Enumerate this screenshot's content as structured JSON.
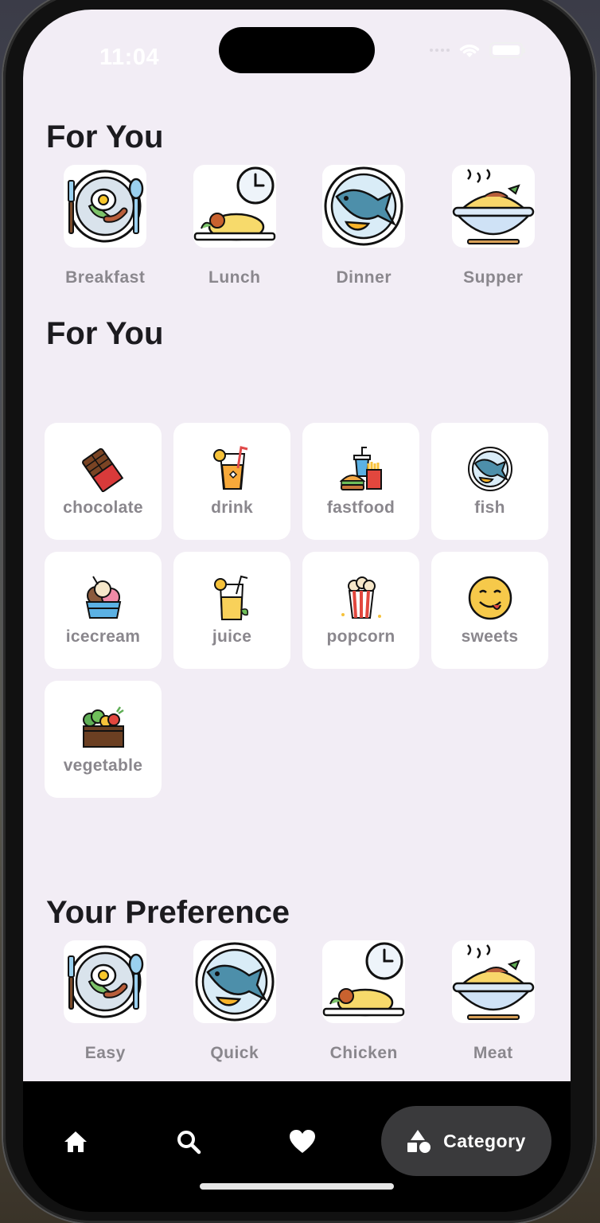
{
  "status": {
    "time": "11:04"
  },
  "sections": {
    "for_you_1": {
      "title": "For You"
    },
    "for_you_2": {
      "title": "For You"
    },
    "preference": {
      "title": "Your Preference"
    }
  },
  "meals": [
    {
      "label": "Breakfast",
      "icon": "breakfast-plate-icon"
    },
    {
      "label": "Lunch",
      "icon": "lunch-clock-icon"
    },
    {
      "label": "Dinner",
      "icon": "fish-plate-icon"
    },
    {
      "label": "Supper",
      "icon": "bowl-icon"
    }
  ],
  "categories": [
    {
      "label": "chocolate",
      "icon": "chocolate-icon"
    },
    {
      "label": "drink",
      "icon": "drink-icon"
    },
    {
      "label": "fastfood",
      "icon": "fastfood-icon"
    },
    {
      "label": "fish",
      "icon": "fish-icon"
    },
    {
      "label": "icecream",
      "icon": "icecream-icon"
    },
    {
      "label": "juice",
      "icon": "juice-icon"
    },
    {
      "label": "popcorn",
      "icon": "popcorn-icon"
    },
    {
      "label": "sweets",
      "icon": "sweets-icon"
    },
    {
      "label": "vegetable",
      "icon": "vegetable-icon"
    }
  ],
  "preferences": [
    {
      "label": "Easy",
      "icon": "breakfast-plate-icon"
    },
    {
      "label": "Quick",
      "icon": "fish-plate-icon"
    },
    {
      "label": "Chicken",
      "icon": "lunch-clock-icon"
    },
    {
      "label": "Meat",
      "icon": "bowl-icon"
    }
  ],
  "nav": {
    "items": [
      "home-icon",
      "search-icon",
      "heart-icon"
    ],
    "active_label": "Category"
  },
  "colors": {
    "background": "#f2edf5",
    "label_gray": "#8a878d",
    "title": "#1c1b1f",
    "nav": "#000000",
    "pill": "#3a3a3c"
  }
}
